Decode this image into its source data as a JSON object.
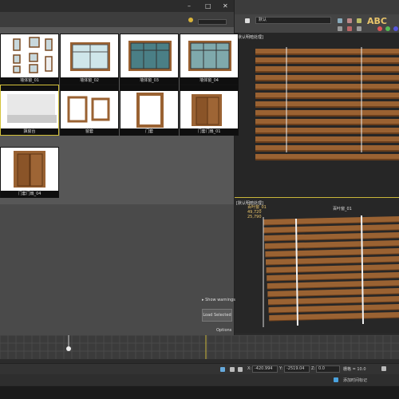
{
  "asset_browser": {
    "window_buttons": [
      "–",
      "□",
      "✕"
    ],
    "thumbnails": [
      {
        "label": "墙体窗_01"
      },
      {
        "label": "墙体窗_02"
      },
      {
        "label": "墙体窗_03"
      },
      {
        "label": "墙体窗_04"
      },
      {
        "label": "飘窗台"
      },
      {
        "label": "窗套"
      },
      {
        "label": "门套"
      },
      {
        "label": "门套门扇_01"
      },
      {
        "label": "门套门扇_04"
      }
    ],
    "show_warnings": "Show warnings",
    "load_selected": "Load Selected",
    "options": "Options"
  },
  "max": {
    "dropdown_value": "默认",
    "abc_letters": "ABC",
    "viewport_top_label": "[默认明暗处理]",
    "viewport_bottom_label": "[默认明暗处理]",
    "stats": [
      "百叶窗_01",
      "49,720",
      "25,790"
    ],
    "object_name": "百叶窗_01",
    "x_label": "X:",
    "x_value": "-420.994",
    "y_label": "Y:",
    "y_value": "-2519.04",
    "z_label": "Z:",
    "z_value": "0.0",
    "grid_label": "栅格 = 10.0",
    "add_time_tag": "添加时间标记"
  },
  "colors": {
    "wood": "#9a6232",
    "wood_dark": "#6b3f1c",
    "selection": "#d4c23a",
    "accent_text": "#e9c46a"
  }
}
